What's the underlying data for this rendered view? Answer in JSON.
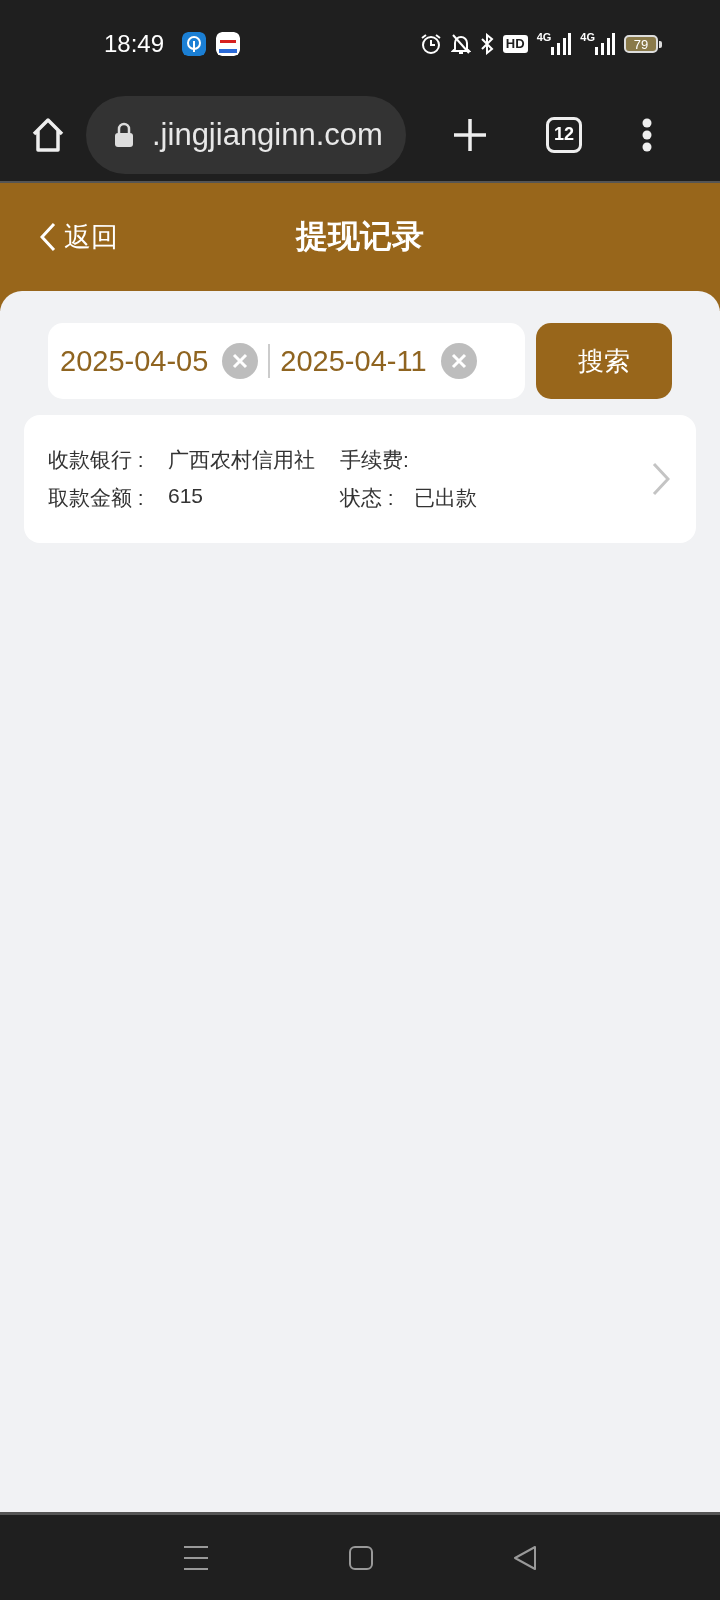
{
  "status_bar": {
    "time": "18:49",
    "hd_label": "HD",
    "network_labels": [
      "4G",
      "4G"
    ],
    "battery": "79"
  },
  "browser": {
    "url": ".jingjianginn.com",
    "tab_count": "12"
  },
  "header": {
    "back": "返回",
    "title": "提现记录"
  },
  "search": {
    "start_date": "2025-04-05",
    "end_date": "2025-04-11",
    "button": "搜索"
  },
  "records": [
    {
      "bank_label": "收款银行 :",
      "bank": "广西农村信用社",
      "fee_label": "手续费:",
      "amount_label": "取款金额 :",
      "amount": "615",
      "status_label": "状态 :",
      "status": "已出款"
    }
  ]
}
